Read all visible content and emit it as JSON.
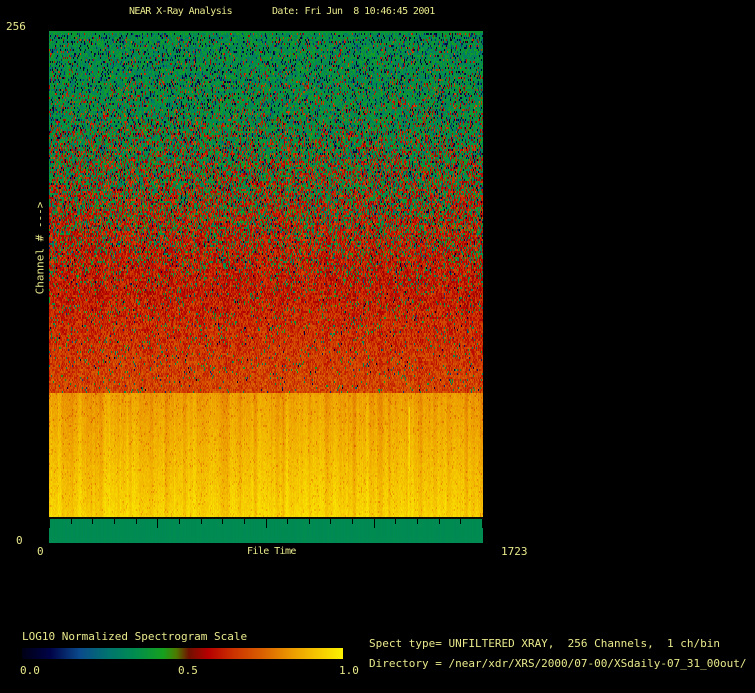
{
  "window": {
    "background": "#000000",
    "text_color": "#e9e98c"
  },
  "header": {
    "title": "NEAR X-Ray Analysis",
    "date": "Date: Fri Jun  8 10:46:45 2001"
  },
  "plot": {
    "y_axis": {
      "title": "Channel # --->",
      "max_label": "256",
      "min_label": "0"
    },
    "x_axis": {
      "title": "File Time",
      "min_label": "0",
      "max_label": "1723"
    }
  },
  "colorbar": {
    "title": "LOG10 Normalized Spectrogram Scale",
    "tick_labels": [
      "0.0",
      "0.5",
      "1.0"
    ]
  },
  "info": {
    "spect_line": "Spect type= UNFILTERED XRAY,  256 Channels,  1 ch/bin",
    "directory_line": "Directory = /near/xdr/XRS/2000/07-00/XSdaily-07_31_00out/"
  },
  "chart_data": {
    "type": "heatmap",
    "title": "NEAR X-Ray Analysis",
    "xlabel": "File Time",
    "ylabel": "Channel #",
    "xlim": [
      0,
      1723
    ],
    "ylim": [
      0,
      256
    ],
    "n_channels": 256,
    "channels_per_bin": 1,
    "spect_type": "UNFILTERED XRAY",
    "colorbar_label": "LOG10 Normalized Spectrogram Scale",
    "colorbar_ticks": [
      0.0,
      0.5,
      1.0
    ],
    "colormap_stops": [
      [
        0.0,
        "#000014"
      ],
      [
        0.09,
        "#000448"
      ],
      [
        0.18,
        "#0a4a8c"
      ],
      [
        0.27,
        "#00746e"
      ],
      [
        0.35,
        "#008c50"
      ],
      [
        0.44,
        "#16a01e"
      ],
      [
        0.48,
        "#4c7c00"
      ],
      [
        0.52,
        "#701000"
      ],
      [
        0.58,
        "#b60000"
      ],
      [
        0.66,
        "#cc3300"
      ],
      [
        0.75,
        "#da6000"
      ],
      [
        0.85,
        "#eda000"
      ],
      [
        0.93,
        "#f6cc00"
      ],
      [
        1.0,
        "#fbf200"
      ]
    ],
    "bands": [
      {
        "channels": [
          0,
          12
        ],
        "norm_value": [
          0.34,
          0.36
        ],
        "appearance": "uniform teal-green band with black x-axis tick marks"
      },
      {
        "channels": [
          12,
          75
        ],
        "norm_value": [
          0.8,
          0.95
        ],
        "appearance": "bright yellow-orange band, brightest toward lower channels, vertical striping, bright streak near file time 1429"
      },
      {
        "channels": [
          75,
          126
        ],
        "norm_value": [
          0.6,
          0.75
        ],
        "appearance": "bright orange-red noisy region"
      },
      {
        "channels": [
          126,
          216
        ],
        "norm_value": [
          0.3,
          0.7
        ],
        "appearance": "mixed red and green speckle noise, red fraction grows toward lower channels"
      },
      {
        "channels": [
          216,
          256
        ],
        "norm_value": [
          0.05,
          0.45
        ],
        "appearance": "green noise with dark navy speckles at highest channels"
      }
    ],
    "grid": false,
    "legend_position": "none"
  }
}
